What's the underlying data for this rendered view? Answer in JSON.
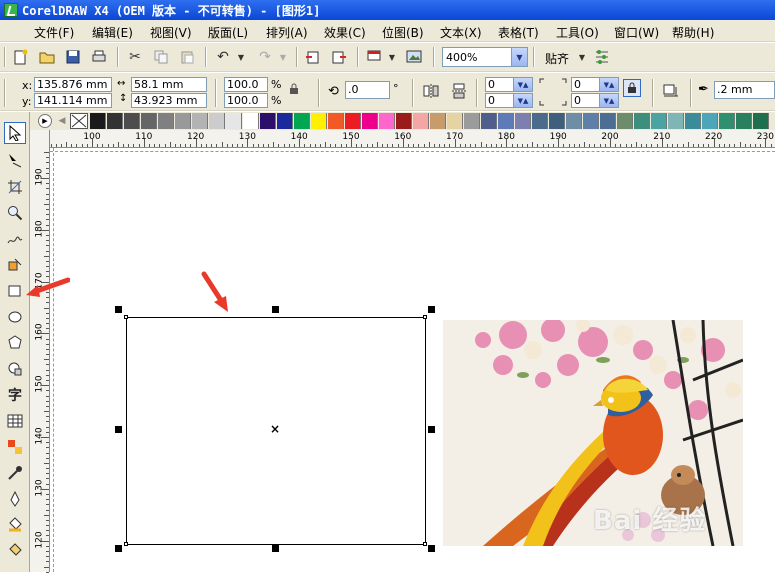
{
  "window": {
    "title": "CorelDRAW X4 (OEM 版本 - 不可转售) - [图形1]"
  },
  "menu": {
    "items": [
      "文件(F)",
      "编辑(E)",
      "视图(V)",
      "版面(L)",
      "排列(A)",
      "效果(C)",
      "位图(B)",
      "文本(X)",
      "表格(T)",
      "工具(O)",
      "窗口(W)",
      "帮助(H)"
    ]
  },
  "toolbar": {
    "zoom": "400%",
    "snap_label": "贴齐"
  },
  "property_bar": {
    "x_label": "x:",
    "y_label": "y:",
    "x_value": "135.876 mm",
    "y_value": "141.114 mm",
    "width_value": "58.1 mm",
    "height_value": "43.923 mm",
    "scale_x": "100.0",
    "scale_y": "100.0",
    "percent_symbol": "%",
    "rotation": ".0",
    "degree_symbol": "°",
    "corner_tl": "0",
    "corner_bl": "0",
    "corner_tr": "0",
    "corner_br": "0",
    "outline_width": ".2 mm"
  },
  "palette": {
    "colors": [
      "#1a1a1a",
      "#333333",
      "#4d4d4d",
      "#666666",
      "#808080",
      "#999999",
      "#b3b3b3",
      "#cccccc",
      "#e6e6e6",
      "#ffffff",
      "#2b0f6b",
      "#1a2a9e",
      "#00a651",
      "#ffef00",
      "#f15a24",
      "#ed1c24",
      "#ec008c",
      "#ff66cc",
      "#9b1b1b",
      "#f4a6a6",
      "#c69c6d",
      "#e6d3a3",
      "#9b9b9b",
      "#4f5e8c",
      "#5c7bb8",
      "#7d7fb0",
      "#4a6b8c",
      "#3f5f7f",
      "#6d8ea6",
      "#5e7fa8",
      "#4c6e94",
      "#6c8c6c",
      "#3e8e7e",
      "#4ca3a3",
      "#7fb5b5",
      "#3a8c9a",
      "#4da6b8",
      "#2f8f6f",
      "#2a7f5f",
      "#1f6f4f"
    ]
  },
  "rulers": {
    "horizontal": [
      "100",
      "110",
      "120",
      "130",
      "140",
      "150",
      "160",
      "170",
      "180",
      "190",
      "200",
      "210",
      "220",
      "230"
    ],
    "vertical": [
      "190",
      "180",
      "170",
      "160",
      "150",
      "140",
      "130",
      "120"
    ]
  },
  "tools": [
    "pick-tool",
    "shape-tool",
    "crop-tool",
    "zoom-tool",
    "freehand-tool",
    "smart-fill-tool",
    "rectangle-tool",
    "ellipse-tool",
    "polygon-tool",
    "basic-shapes-tool",
    "text-tool",
    "table-tool",
    "interactive-tool",
    "eyedropper-tool",
    "outline-tool",
    "fill-tool",
    "interactive-fill-tool"
  ],
  "image": {
    "watermark": "Bai 经验",
    "bird_colors": [
      "#f2c21b",
      "#e0561d",
      "#b8311a",
      "#2f5fa0"
    ]
  }
}
